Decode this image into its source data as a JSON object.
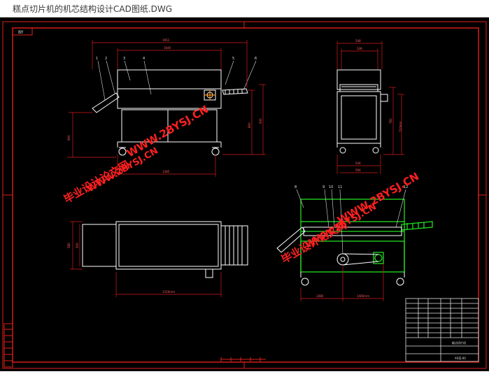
{
  "window": {
    "title": "糕点切片机的机芯结构设计CAD图纸.DWG"
  },
  "colors": {
    "background": "#000000",
    "frame": "#e0201c",
    "machine": "#ffffff",
    "dimension": "#d91a1a",
    "green": "#22dd22",
    "watermark": "#ff2020"
  },
  "drawing": {
    "corner_tag": "BY",
    "front_view": {
      "dims": {
        "overall_width": "1951",
        "inner_width": "1640",
        "lower_width": "1385",
        "height_left": "900",
        "height_right_a": "800",
        "height_right_b": "930"
      },
      "balloons": [
        "1",
        "2",
        "3",
        "4",
        "5",
        "6"
      ]
    },
    "side_view": {
      "dims": {
        "top_a": "548",
        "top_b": "338",
        "bottom_a": "544",
        "bottom_b": "594",
        "height_a": "783",
        "height_b": "710mm"
      }
    },
    "top_view": {
      "dims": {
        "depth_a": "580",
        "depth_b": "500",
        "length": "1310mm"
      }
    },
    "section_view": {
      "dims": {
        "left": "1480",
        "right": "1485mm"
      },
      "balloons": [
        "8",
        "9",
        "10",
        "11",
        "12"
      ]
    },
    "title_block": {
      "name_cell": "糕点切片机",
      "code_cell": "XXZJ-00"
    }
  },
  "watermarks": {
    "company": "毕业设计论文网",
    "site": "WWW.2BYSJ.CN"
  }
}
